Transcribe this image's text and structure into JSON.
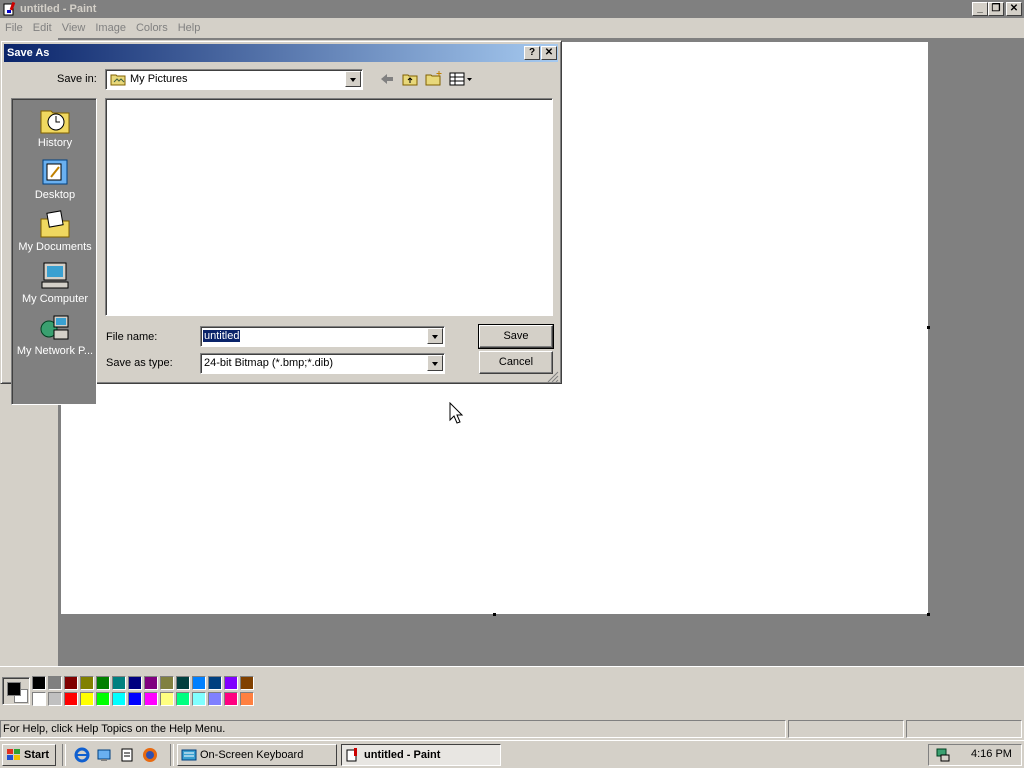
{
  "app": {
    "title": "untitled - Paint",
    "controls": {
      "minimize": "_",
      "maximize": "❐",
      "close": "✕"
    }
  },
  "menu": [
    "File",
    "Edit",
    "View",
    "Image",
    "Colors",
    "Help"
  ],
  "palette": {
    "foreground": "#000000",
    "background": "#ffffff",
    "top_row": [
      "#000000",
      "#808080",
      "#800000",
      "#808000",
      "#008000",
      "#008080",
      "#000080",
      "#800080",
      "#808040",
      "#004040",
      "#0080ff",
      "#004080",
      "#8000ff",
      "#804000"
    ],
    "bottom_row": [
      "#ffffff",
      "#c0c0c0",
      "#ff0000",
      "#ffff00",
      "#00ff00",
      "#00ffff",
      "#0000ff",
      "#ff00ff",
      "#ffff80",
      "#00ff80",
      "#80ffff",
      "#8080ff",
      "#ff0080",
      "#ff8040"
    ]
  },
  "status": {
    "help_text": "For Help, click Help Topics on the Help Menu."
  },
  "dialog": {
    "title": "Save As",
    "help_btn": "?",
    "close_btn": "✕",
    "save_in_label": "Save in:",
    "save_in_value": "My Pictures",
    "places": [
      "History",
      "Desktop",
      "My Documents",
      "My Computer",
      "My Network P..."
    ],
    "file_name_label": "File name:",
    "file_name_value": "untitled",
    "save_type_label": "Save as type:",
    "save_type_value": "24-bit Bitmap (*.bmp;*.dib)",
    "save_button": "Save",
    "cancel_button": "Cancel"
  },
  "taskbar": {
    "start": "Start",
    "tasks": [
      "On-Screen Keyboard",
      "untitled - Paint"
    ],
    "clock": "4:16 PM"
  }
}
